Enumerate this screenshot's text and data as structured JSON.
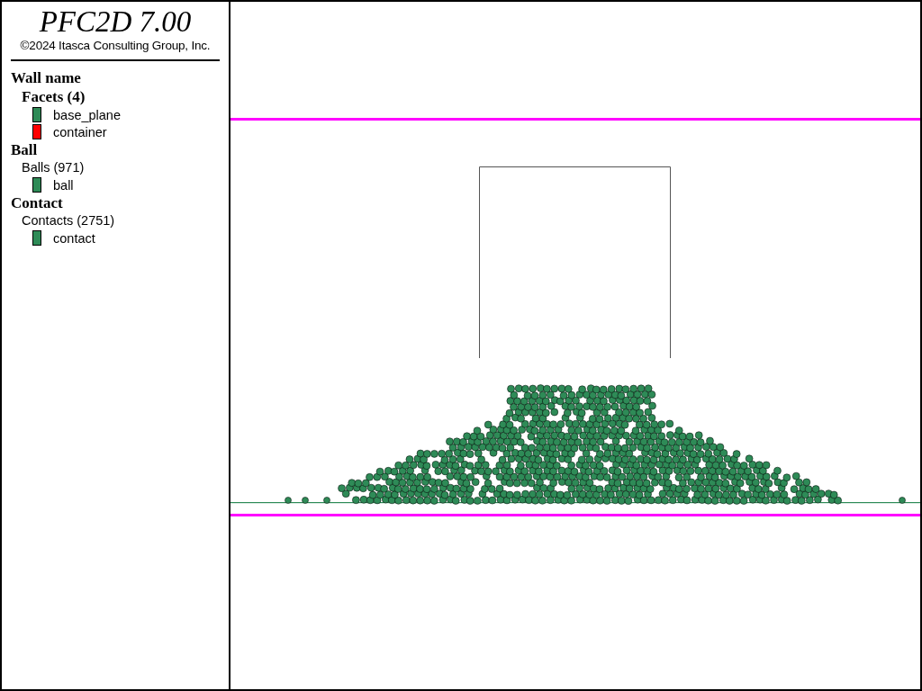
{
  "legend": {
    "title": "PFC2D 7.00",
    "copyright": "©2024 Itasca Consulting Group, Inc.",
    "sections": [
      {
        "heading": "Wall name",
        "group": {
          "label": "Facets (4)",
          "kind": "bold"
        },
        "items": [
          {
            "label": "base_plane",
            "color": "#2e8b57"
          },
          {
            "label": "container",
            "color": "#ff0000"
          }
        ]
      },
      {
        "heading": "Ball",
        "group": {
          "label": "Balls (971)",
          "kind": "plain"
        },
        "items": [
          {
            "label": "ball",
            "color": "#2e8b57"
          }
        ]
      },
      {
        "heading": "Contact",
        "group": {
          "label": "Contacts (2751)",
          "kind": "plain"
        },
        "items": [
          {
            "label": "contact",
            "color": "#2e8b57"
          }
        ]
      }
    ]
  }
}
